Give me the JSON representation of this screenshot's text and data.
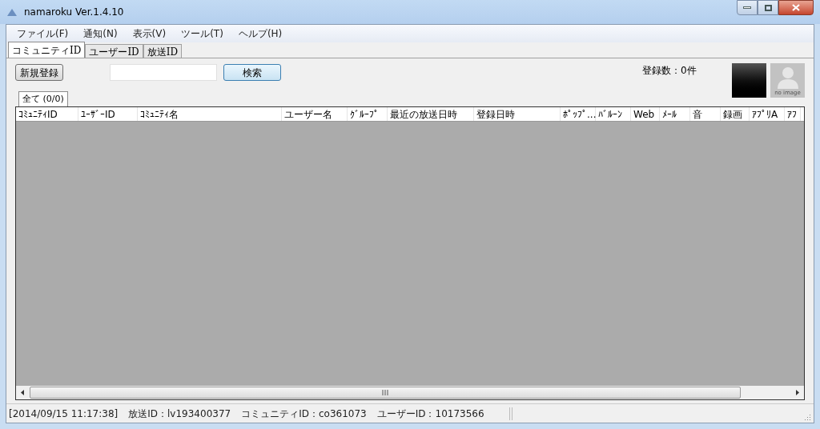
{
  "window": {
    "title": "namaroku Ver.1.4.10"
  },
  "menu": [
    "ファイル(F)",
    "通知(N)",
    "表示(V)",
    "ツール(T)",
    "ヘルプ(H)"
  ],
  "tabs": [
    {
      "label": "コミュニティID",
      "selected": true
    },
    {
      "label": "ユーザーID",
      "selected": false
    },
    {
      "label": "放送ID",
      "selected": false
    }
  ],
  "toolbar": {
    "new_button": "新規登録",
    "search_button": "検索",
    "count": "登録数：0件",
    "avatar_caption": "no image"
  },
  "list_tabs": [
    {
      "label": "全て (0/0)",
      "selected": true
    }
  ],
  "table": {
    "columns": [
      "ｺﾐｭﾆﾃｨID",
      "ﾕｰｻﾞｰID",
      "ｺﾐｭﾆﾃｨ名",
      "ユーザー名",
      "ｸﾞﾙｰﾌﾟ",
      "最近の放送日時",
      "登録日時",
      "ﾎﾟｯﾌﾟ...",
      "ﾊﾞﾙｰﾝ",
      "Web",
      "ﾒｰﾙ",
      "音",
      "録画",
      "ｱﾌﾟﾘA",
      "ｱﾌ"
    ]
  },
  "status_bar": [
    "[2014/09/15 11:17:38]",
    "放送ID：lv193400377",
    "コミュニティID：co361073",
    "ユーザーID：10173566"
  ]
}
